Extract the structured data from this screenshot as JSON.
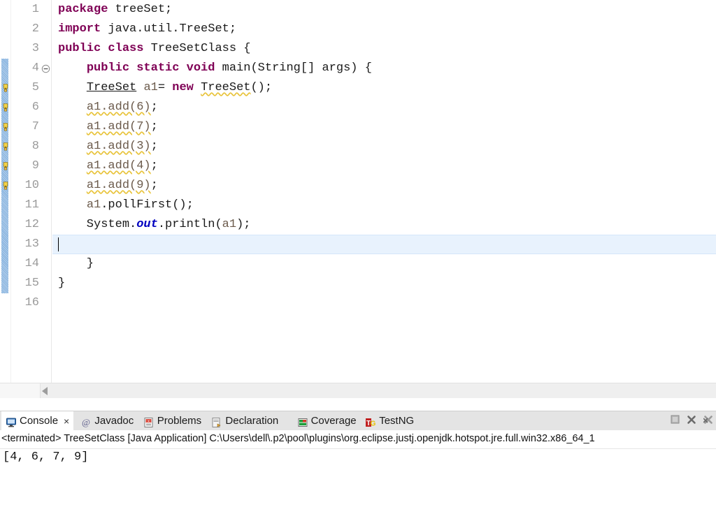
{
  "editor": {
    "lines": [
      {
        "n": "1",
        "segments": [
          {
            "t": "package ",
            "c": "kw"
          },
          {
            "t": "treeSet;",
            "c": ""
          }
        ]
      },
      {
        "n": "2",
        "segments": [
          {
            "t": "import ",
            "c": "kw"
          },
          {
            "t": "java.util.TreeSet;",
            "c": ""
          }
        ]
      },
      {
        "n": "3",
        "segments": [
          {
            "t": "public class ",
            "c": "kw"
          },
          {
            "t": "TreeSetClass {",
            "c": ""
          }
        ]
      },
      {
        "n": "4",
        "segments": [
          {
            "t": "    ",
            "c": ""
          },
          {
            "t": "public static void ",
            "c": "kw"
          },
          {
            "t": "main(String[] args) {",
            "c": ""
          }
        ]
      },
      {
        "n": "5",
        "segments": [
          {
            "t": "    ",
            "c": ""
          },
          {
            "t": "TreeSet",
            "c": "type-u"
          },
          {
            "t": " ",
            "c": ""
          },
          {
            "t": "a1",
            "c": "local"
          },
          {
            "t": "= ",
            "c": ""
          },
          {
            "t": "new ",
            "c": "kw"
          },
          {
            "t": "TreeSet",
            "c": "type-u warnu"
          },
          {
            "t": "();",
            "c": ""
          }
        ]
      },
      {
        "n": "6",
        "segments": [
          {
            "t": "    ",
            "c": ""
          },
          {
            "t": "a1.add(6)",
            "c": "local warnu"
          },
          {
            "t": ";",
            "c": ""
          }
        ]
      },
      {
        "n": "7",
        "segments": [
          {
            "t": "    ",
            "c": ""
          },
          {
            "t": "a1.add(7)",
            "c": "local warnu"
          },
          {
            "t": ";",
            "c": ""
          }
        ]
      },
      {
        "n": "8",
        "segments": [
          {
            "t": "    ",
            "c": ""
          },
          {
            "t": "a1.add(3)",
            "c": "local warnu"
          },
          {
            "t": ";",
            "c": ""
          }
        ]
      },
      {
        "n": "9",
        "segments": [
          {
            "t": "    ",
            "c": ""
          },
          {
            "t": "a1.add(4)",
            "c": "local warnu"
          },
          {
            "t": ";",
            "c": ""
          }
        ]
      },
      {
        "n": "10",
        "segments": [
          {
            "t": "    ",
            "c": ""
          },
          {
            "t": "a1.add(9)",
            "c": "local warnu"
          },
          {
            "t": ";",
            "c": ""
          }
        ]
      },
      {
        "n": "11",
        "segments": [
          {
            "t": "    ",
            "c": ""
          },
          {
            "t": "a1",
            "c": "local"
          },
          {
            "t": ".pollFirst();",
            "c": ""
          }
        ]
      },
      {
        "n": "12",
        "segments": [
          {
            "t": "    System.",
            "c": ""
          },
          {
            "t": "out",
            "c": "field"
          },
          {
            "t": ".println(",
            "c": ""
          },
          {
            "t": "a1",
            "c": "local"
          },
          {
            "t": ");",
            "c": ""
          }
        ]
      },
      {
        "n": "13",
        "segments": []
      },
      {
        "n": "14",
        "segments": [
          {
            "t": "    }",
            "c": ""
          }
        ]
      },
      {
        "n": "15",
        "segments": [
          {
            "t": "}",
            "c": ""
          }
        ]
      },
      {
        "n": "16",
        "segments": []
      }
    ],
    "current_line": 13,
    "fold_marker_line": 4,
    "warning_lines": [
      5,
      6,
      7,
      8,
      9,
      10
    ],
    "range_start_line": 4,
    "range_end_line": 15
  },
  "console": {
    "tabs": [
      {
        "label": "Console",
        "icon": "console-icon",
        "active": true,
        "closable": true
      },
      {
        "label": "Javadoc",
        "icon": "javadoc-icon",
        "active": false,
        "closable": false
      },
      {
        "label": "Problems",
        "icon": "problems-icon",
        "active": false,
        "closable": false
      },
      {
        "label": "Declaration",
        "icon": "declaration-icon",
        "active": false,
        "closable": false
      },
      {
        "label": "Coverage",
        "icon": "coverage-icon",
        "active": false,
        "closable": false
      },
      {
        "label": "TestNG",
        "icon": "testng-icon",
        "active": false,
        "closable": false
      }
    ],
    "close_glyph": "×",
    "toolbar": [
      {
        "name": "terminate-button",
        "glyph": ""
      },
      {
        "name": "remove-launch-button",
        "glyph": "✖"
      },
      {
        "name": "remove-all-terminated-button",
        "glyph": "✖"
      }
    ],
    "terminated_line": "<terminated> TreeSetClass [Java Application] C:\\Users\\dell\\.p2\\pool\\plugins\\org.eclipse.justj.openjdk.hotspot.jre.full.win32.x86_64_1",
    "output": "[4, 6, 7, 9]"
  },
  "colors": {
    "keyword": "#7f0055",
    "field": "#0000c0",
    "local_var": "#6b5a4b",
    "warning_squiggle": "#e8c33a",
    "current_line_bg": "#e8f2fd",
    "range_bar": "#7faedd",
    "line_number": "#9a9a9a",
    "tabbar_bg": "#e4e4e4"
  }
}
